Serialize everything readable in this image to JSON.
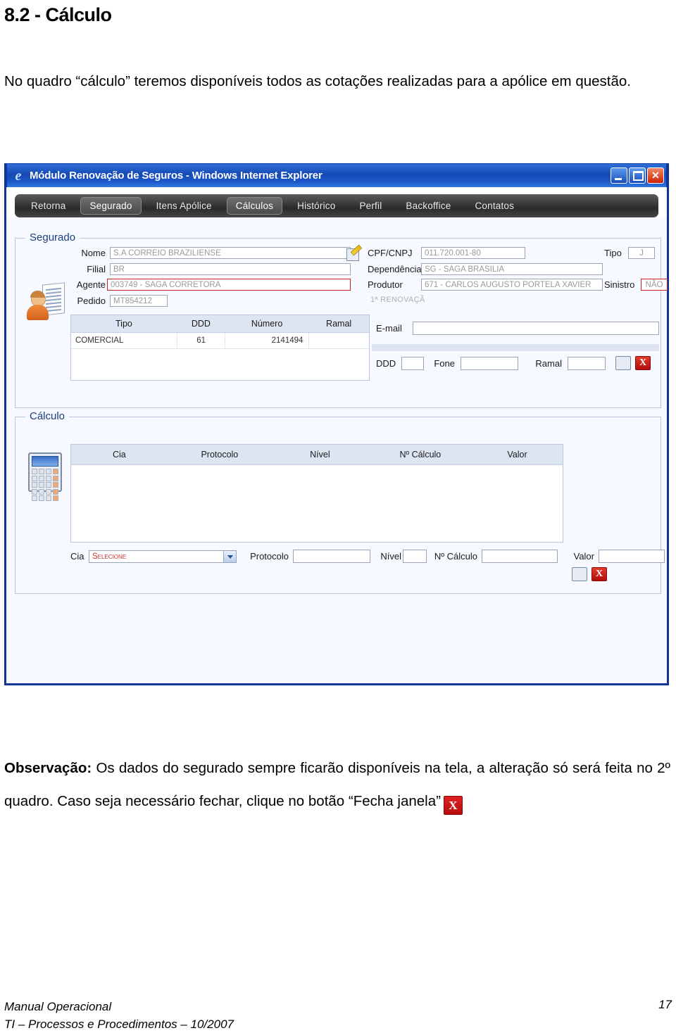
{
  "document": {
    "heading": "8.2 - Cálculo",
    "intro": "No quadro “cálculo” teremos disponíveis todos as cotações realizadas para a apólice em questão.",
    "observation_label": "Observação:",
    "observation_text": " Os dados do segurado sempre ficarão disponíveis na tela, a alteração só será feita no 2º quadro. Caso seja necessário fechar, clique no botão “Fecha janela”",
    "close_button_glyph": "X",
    "footer_line1": "Manual Operacional",
    "footer_line2": "TI – Processos e Procedimentos – 10/2007",
    "page_number": "17"
  },
  "window": {
    "title": "Módulo Renovação de Seguros - Windows Internet Explorer",
    "minimize_label": "",
    "maximize_label": "",
    "close_label": "",
    "nav_tabs": [
      {
        "label": "Retorna",
        "active": false
      },
      {
        "label": "Segurado",
        "active": true
      },
      {
        "label": "Itens Apólice",
        "active": false
      },
      {
        "label": "Cálculos",
        "active": true
      },
      {
        "label": "Histórico",
        "active": false
      },
      {
        "label": "Perfil",
        "active": false
      },
      {
        "label": "Backoffice",
        "active": false
      },
      {
        "label": "Contatos",
        "active": false
      }
    ]
  },
  "segurado": {
    "panel_title": "Segurado",
    "fields": {
      "nome_label": "Nome",
      "nome_value": "S.A CORREIO BRAZILIENSE",
      "filial_label": "Filial",
      "filial_value": "BR",
      "agente_label": "Agente",
      "agente_value": "003749 - SAGA CORRETORA",
      "pedido_label": "Pedido",
      "pedido_value": "MT854212",
      "cpf_label": "CPF/CNPJ",
      "cpf_value": "011.720.001-80",
      "tipo_label": "Tipo",
      "tipo_value": "J",
      "dependencia_label": "Dependência",
      "dependencia_value": "SG - SAGA BRASILIA",
      "produtor_label": "Produtor",
      "produtor_value": "671 - CARLOS AUGUSTO PORTELA XAVIER",
      "sinistro_label": "Sinistro",
      "sinistro_value": "NÃO",
      "renovacao_note": "1ª RENOVAÇÃ"
    },
    "phone_table": {
      "headers": [
        "Tipo",
        "DDD",
        "Número",
        "Ramal"
      ],
      "rows": [
        {
          "tipo": "COMERCIAL",
          "ddd": "61",
          "numero": "2141494",
          "ramal": ""
        }
      ]
    },
    "contact_form": {
      "email_label": "E-mail",
      "email_value": "",
      "ddd_label": "DDD",
      "ddd_value": "",
      "fone_label": "Fone",
      "fone_value": "",
      "ramal_label": "Ramal",
      "ramal_value": "",
      "save_glyph": "",
      "close_glyph": "X"
    }
  },
  "calculo": {
    "panel_title": "Cálculo",
    "table": {
      "headers": [
        "Cia",
        "Protocolo",
        "Nível",
        "Nº Cálculo",
        "Valor"
      ],
      "rows": []
    },
    "entry_form": {
      "cia_label": "Cia",
      "cia_value": "Selecione",
      "protocolo_label": "Protocolo",
      "protocolo_value": "",
      "nivel_label": "Nível",
      "nivel_value": "",
      "ncalculo_label": "Nº Cálculo",
      "ncalculo_value": "",
      "valor_label": "Valor",
      "valor_value": "",
      "save_glyph": "",
      "close_glyph": "X"
    }
  },
  "colors": {
    "window_border": "#113399",
    "titlebar_blue": "#1549b4",
    "panel_bg": "#f6f9ff",
    "alert_red": "#cc2222",
    "select_text_red": "#cc3333"
  }
}
